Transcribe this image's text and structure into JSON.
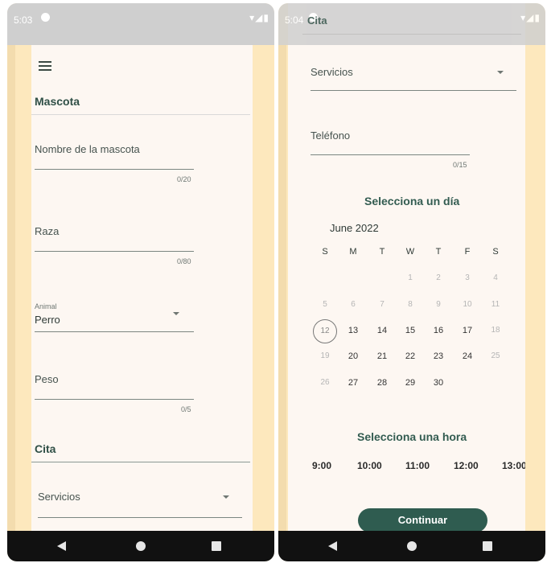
{
  "left_screen": {
    "status": {
      "time": "5:03"
    },
    "mascota_section": {
      "title": "Mascota"
    },
    "fields": {
      "pet_name": {
        "label": "Nombre de la mascota",
        "counter": "0/20"
      },
      "breed": {
        "label": "Raza",
        "counter": "0/80"
      },
      "animal": {
        "label": "Animal",
        "value": "Perro"
      },
      "weight": {
        "label": "Peso",
        "counter": "0/5"
      }
    },
    "cita_section": {
      "title": "Cita"
    },
    "services": {
      "label": "Servicios"
    }
  },
  "right_screen": {
    "status": {
      "time": "5:04"
    },
    "cita_section": {
      "title": "Cita"
    },
    "services": {
      "label": "Servicios"
    },
    "phone": {
      "label": "Teléfono",
      "counter": "0/15"
    },
    "day_heading": "Selecciona un día",
    "calendar": {
      "month": "June 2022",
      "weekdays": [
        "S",
        "M",
        "T",
        "W",
        "T",
        "F",
        "S"
      ],
      "weeks": [
        [
          "",
          "",
          "",
          "1",
          "2",
          "3",
          "4"
        ],
        [
          "5",
          "6",
          "7",
          "8",
          "9",
          "10",
          "11"
        ],
        [
          "12",
          "13",
          "14",
          "15",
          "16",
          "17",
          "18"
        ],
        [
          "19",
          "20",
          "21",
          "22",
          "23",
          "24",
          "25"
        ],
        [
          "26",
          "27",
          "28",
          "29",
          "30",
          "",
          ""
        ]
      ],
      "today": "12",
      "enabled_days": [
        "13",
        "14",
        "15",
        "16",
        "17",
        "20",
        "21",
        "22",
        "23",
        "24",
        "27",
        "28",
        "29",
        "30"
      ]
    },
    "hour_heading": "Selecciona una hora",
    "times": [
      "9:00",
      "10:00",
      "11:00",
      "12:00",
      "13:00"
    ],
    "continue_label": "Continuar"
  },
  "colors": {
    "accent": "#2f5c50",
    "background": "#fdf7f2",
    "frame": "#fde8bd"
  }
}
